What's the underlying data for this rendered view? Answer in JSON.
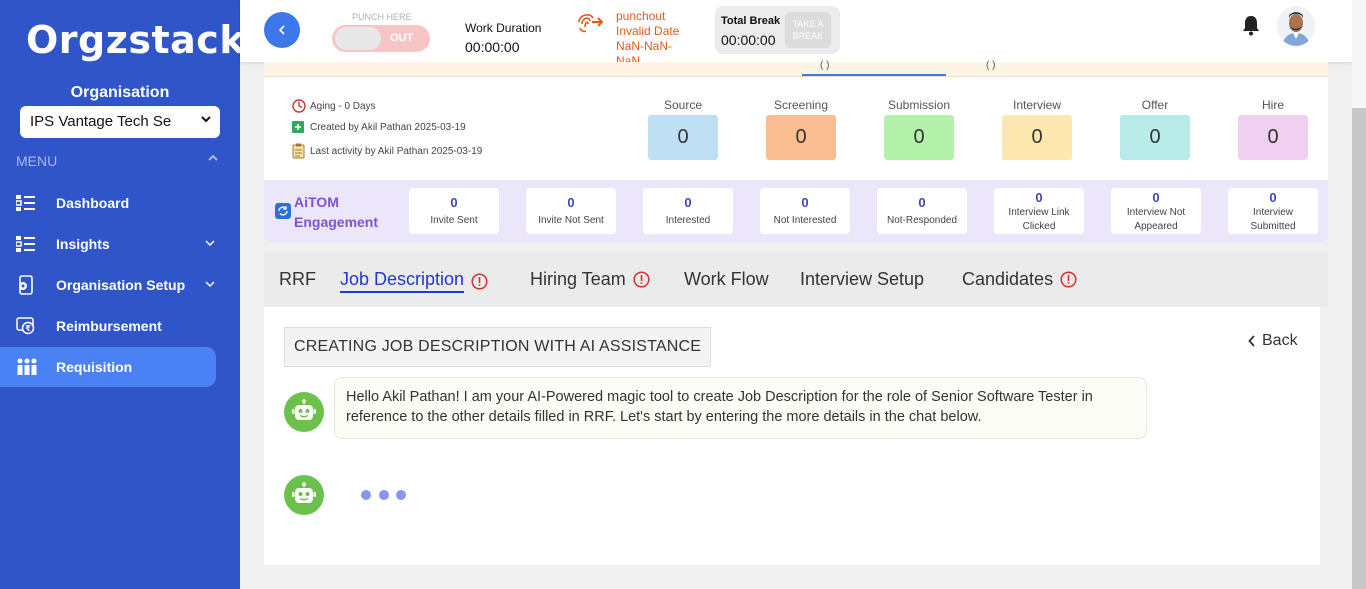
{
  "sidebar": {
    "logo": "Orgzstack",
    "org_label": "Organisation",
    "org_select_value": "IPS Vantage Tech Se",
    "menu_label": "MENU",
    "items": [
      {
        "label": "Dashboard",
        "icon": "dashboard-icon",
        "expandable": false
      },
      {
        "label": "Insights",
        "icon": "insights-icon",
        "expandable": true
      },
      {
        "label": "Organisation Setup",
        "icon": "organisation-setup-icon",
        "expandable": true
      },
      {
        "label": "Reimbursement",
        "icon": "reimbursement-icon",
        "expandable": false
      },
      {
        "label": "Requisition",
        "icon": "requisition-icon",
        "expandable": false,
        "active": true
      }
    ]
  },
  "topbar": {
    "punch_here": "PUNCH HERE",
    "punch_toggle": "OUT",
    "work_duration_label": "Work Duration",
    "work_duration_value": "00:00:00",
    "punchout_line1": "punchout",
    "punchout_line2": "Invalid Date",
    "punchout_line3": "NaN-NaN-",
    "punchout_line4": "NaN",
    "total_break_label": "Total Break",
    "total_break_value": "00:00:00",
    "take_break_line1": "TAKE A",
    "take_break_line2": "BREAK"
  },
  "stage_strip": {
    "left_fragment": "( )",
    "right_fragment": "( )"
  },
  "meta": {
    "aging": "Aging - 0 Days",
    "created_by": "Created by Akil Pathan 2025-03-19",
    "last_activity": "Last activity by Akil Pathan 2025-03-19"
  },
  "stats": [
    {
      "label": "Source",
      "value": "0",
      "color": "#bfe0f4"
    },
    {
      "label": "Screening",
      "value": "0",
      "color": "#fbbd92"
    },
    {
      "label": "Submission",
      "value": "0",
      "color": "#b4f2ac"
    },
    {
      "label": "Interview",
      "value": "0",
      "color": "#fde8b0"
    },
    {
      "label": "Offer",
      "value": "0",
      "color": "#b9ece9"
    },
    {
      "label": "Hire",
      "value": "0",
      "color": "#f0d0f0"
    }
  ],
  "engagement": {
    "title_line1": "AiTOM",
    "title_line2": "Engagement",
    "cards": [
      {
        "value": "0",
        "label_line1": "Invite Sent",
        "label_line2": ""
      },
      {
        "value": "0",
        "label_line1": "Invite Not Sent",
        "label_line2": ""
      },
      {
        "value": "0",
        "label_line1": "Interested",
        "label_line2": ""
      },
      {
        "value": "0",
        "label_line1": "Not Interested",
        "label_line2": ""
      },
      {
        "value": "0",
        "label_line1": "Not-Responded",
        "label_line2": ""
      },
      {
        "value": "0",
        "label_line1": "Interview Link",
        "label_line2": "Clicked"
      },
      {
        "value": "0",
        "label_line1": "Interview Not",
        "label_line2": "Appeared"
      },
      {
        "value": "0",
        "label_line1": "Interview",
        "label_line2": "Submitted"
      }
    ]
  },
  "tabs": [
    {
      "label": "RRF",
      "warning": false,
      "active": false
    },
    {
      "label": "Job Description",
      "warning": true,
      "active": true
    },
    {
      "label": "Hiring Team",
      "warning": true,
      "active": false
    },
    {
      "label": "Work Flow",
      "warning": false,
      "active": false
    },
    {
      "label": "Interview Setup",
      "warning": false,
      "active": false
    },
    {
      "label": "Candidates",
      "warning": true,
      "active": false
    }
  ],
  "content": {
    "section_title": "CREATING JOB DESCRIPTION WITH AI ASSISTANCE",
    "back_label": "Back",
    "bot_message": "Hello Akil Pathan! I am your AI-Powered magic tool to create Job Description for the role of Senior Software Tester in reference to the other details filled in RRF. Let's start by entering the more details in the chat below."
  },
  "colors": {
    "sidebar_bg": "#2f55c9",
    "active_nav": "#4a82f5",
    "accent_blue": "#3c78ea",
    "tab_active": "#2438c9",
    "bot_green": "#6cc14d",
    "warning_red": "#d22f2f",
    "punchout_orange": "#e25b1a"
  }
}
